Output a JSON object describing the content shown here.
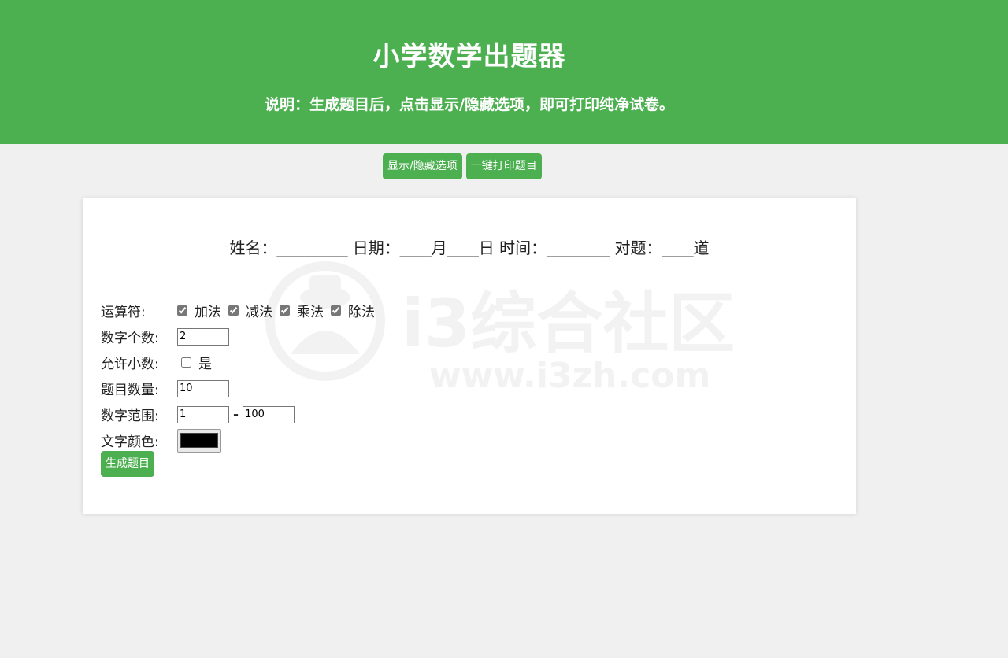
{
  "header": {
    "title": "小学数学出题器",
    "note": "说明：生成题目后，点击显示/隐藏选项，即可打印纯净试卷。"
  },
  "toolbar": {
    "toggle_label": "显示/隐藏选项",
    "print_label": "一键打印题目"
  },
  "watermark": {
    "brand": "i3综合社区",
    "url": "www.i3zh.com"
  },
  "info_line": "姓名：_________ 日期：____月____日 时间：________ 对题：____道",
  "options": {
    "operators_label": "运算符:",
    "operators": [
      {
        "label": "加法",
        "checked": true
      },
      {
        "label": "减法",
        "checked": true
      },
      {
        "label": "乘法",
        "checked": true
      },
      {
        "label": "除法",
        "checked": true
      }
    ],
    "number_count_label": "数字个数:",
    "number_count_value": "2",
    "decimal_label": "允许小数:",
    "decimal_option": "是",
    "decimal_checked": false,
    "question_count_label": "题目数量:",
    "question_count_value": "10",
    "range_label": "数字范围:",
    "range_min": "1",
    "range_sep": "-",
    "range_max": "100",
    "color_label": "文字颜色:",
    "text_color": "#000000"
  },
  "generate_label": "生成题目",
  "colors": {
    "accent": "#4caf50",
    "background": "#f0f0f0"
  }
}
